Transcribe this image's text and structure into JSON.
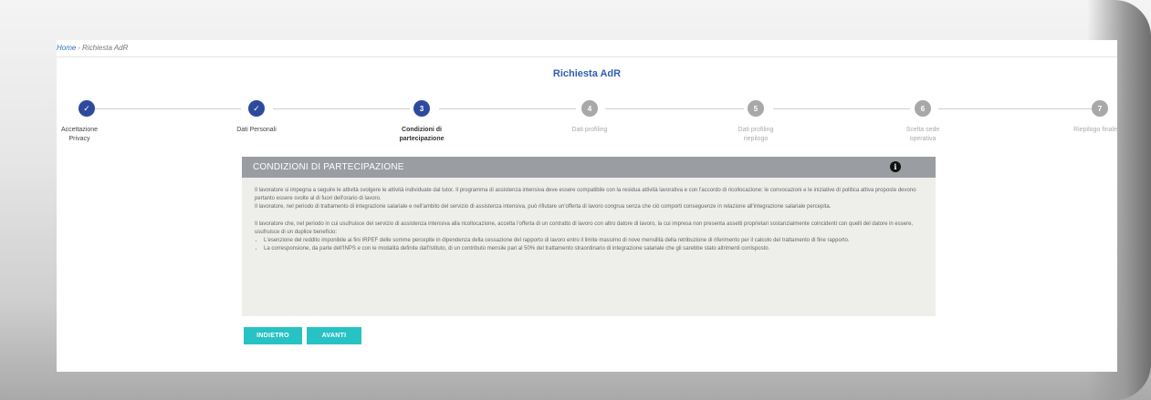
{
  "breadcrumb": {
    "home": "Home",
    "separator": "-",
    "current": "Richiesta AdR"
  },
  "page": {
    "title": "Richiesta AdR"
  },
  "stepper": {
    "steps": [
      {
        "marker": "✓",
        "label_line1": "Accettazione",
        "label_line2": "Privacy",
        "state": "done"
      },
      {
        "marker": "✓",
        "label_line1": "Dati Personali",
        "label_line2": "",
        "state": "done"
      },
      {
        "marker": "3",
        "label_line1": "Condizioni di",
        "label_line2": "partecipazione",
        "state": "active"
      },
      {
        "marker": "4",
        "label_line1": "Dati profiling",
        "label_line2": "",
        "state": "todo"
      },
      {
        "marker": "5",
        "label_line1": "Dati profiling",
        "label_line2": "riepilogo",
        "state": "todo"
      },
      {
        "marker": "6",
        "label_line1": "Scelta sede",
        "label_line2": "operativa",
        "state": "todo"
      },
      {
        "marker": "7",
        "label_line1": "Riepilogo finale",
        "label_line2": "",
        "state": "todo"
      }
    ]
  },
  "panel": {
    "header": "CONDIZIONI DI PARTECIPAZIONE",
    "info_icon": "info-icon",
    "paragraph1": "Il lavoratore si impegna a seguire le attività svolgere le attività individuate dal tutor. Il programma di assistenza intensiva deve essere compatibile con la residua attività lavorativa e con l'accordo di ricollocazione: le convocazioni e le iniziative di politica attiva proposte devono pertanto essere svolte al di fuori dell'orario di lavoro.",
    "paragraph2": "Il lavoratore, nel periodo di trattamento di integrazione salariale e nell'ambito del servizio di assistenza intensiva, può rifiutare un'offerta di lavoro congrua senza che ciò comporti conseguenze in relazione all'integrazione salariale percepita.",
    "paragraph3": "Il lavoratore che, nel periodo in cui usufruisce del servizio di assistenza intensiva alla ricollocazione, accetta l'offerta di un contratto di lavoro con altro datore di lavoro, la cui impresa non presenta assetti proprietari sostanzialmente coincidenti con quelli del datore in essere, usufruisce di un duplice beneficio:",
    "bullets": [
      "L'esenzione del reddito imponibile ai fini IRPEF delle somme percepite in dipendenza della cessazione del rapporto di lavoro entro il limite massimo di nove mensilità della retribuzione di riferimento per il calcolo del trattamento di fine rapporto.",
      "La corresponsione, da parte dell'INPS e con le modalità definite dall'Istituto, di un contributo mensile pari al 50% del trattamento straordinario di integrazione salariale che gli sarebbe stato altrimenti corrisposto."
    ]
  },
  "buttons": {
    "back": "INDIETRO",
    "next": "AVANTI"
  },
  "colors": {
    "accent": "#27c2c4",
    "step_done": "#2d4a9c",
    "step_todo": "#a8a8a8",
    "title": "#2f5fae"
  }
}
